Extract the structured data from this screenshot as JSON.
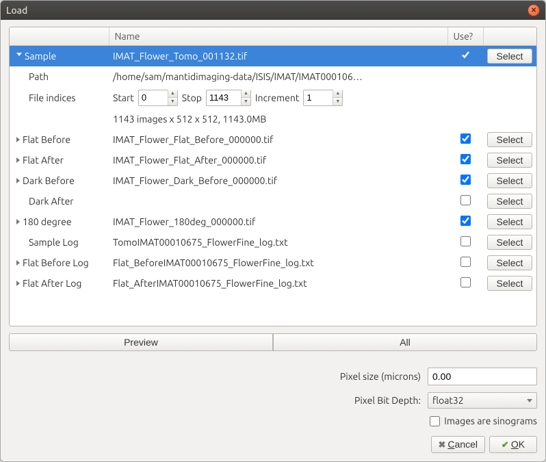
{
  "window": {
    "title": "Load"
  },
  "columns": {
    "c0": "",
    "c1": "Name",
    "c2": "Use?",
    "c3": ""
  },
  "select_label": "Select",
  "rows": {
    "sample": {
      "label": "Sample",
      "name": "IMAT_Flower_Tomo_001132.tif",
      "use": true
    },
    "path": {
      "label": "Path",
      "value": "/home/sam/mantidimaging-data/ISIS/IMAT/IMAT000106…"
    },
    "indices": {
      "label": "File indices",
      "start_label": "Start",
      "start": "0",
      "stop_label": "Stop",
      "stop": "1143",
      "inc_label": "Increment",
      "inc": "1"
    },
    "stats": "1143 images x 512 x 512, 1143.0MB",
    "flat_before": {
      "label": "Flat Before",
      "name": "IMAT_Flower_Flat_Before_000000.tif",
      "use": true
    },
    "flat_after": {
      "label": "Flat After",
      "name": "IMAT_Flower_Flat_After_000000.tif",
      "use": true
    },
    "dark_before": {
      "label": "Dark Before",
      "name": "IMAT_Flower_Dark_Before_000000.tif",
      "use": true
    },
    "dark_after": {
      "label": "Dark After",
      "name": "",
      "use": false
    },
    "deg180": {
      "label": "180 degree",
      "name": "IMAT_Flower_180deg_000000.tif",
      "use": true
    },
    "sample_log": {
      "label": "Sample Log",
      "name": "TomoIMAT00010675_FlowerFine_log.txt",
      "use": false
    },
    "flat_before_log": {
      "label": "Flat Before Log",
      "name": "Flat_BeforeIMAT00010675_FlowerFine_log.txt",
      "use": false
    },
    "flat_after_log": {
      "label": "Flat After Log",
      "name": "Flat_AfterIMAT00010675_FlowerFine_log.txt",
      "use": false
    }
  },
  "buttons": {
    "preview": "Preview",
    "all": "All",
    "cancel": "Cancel",
    "ok": "OK"
  },
  "form": {
    "pixel_size_label": "Pixel size (microns)",
    "pixel_size_value": "0.00",
    "bit_depth_label": "Pixel Bit Depth:",
    "bit_depth_value": "float32",
    "sinograms_label": "Images are sinograms",
    "sinograms_checked": false
  }
}
